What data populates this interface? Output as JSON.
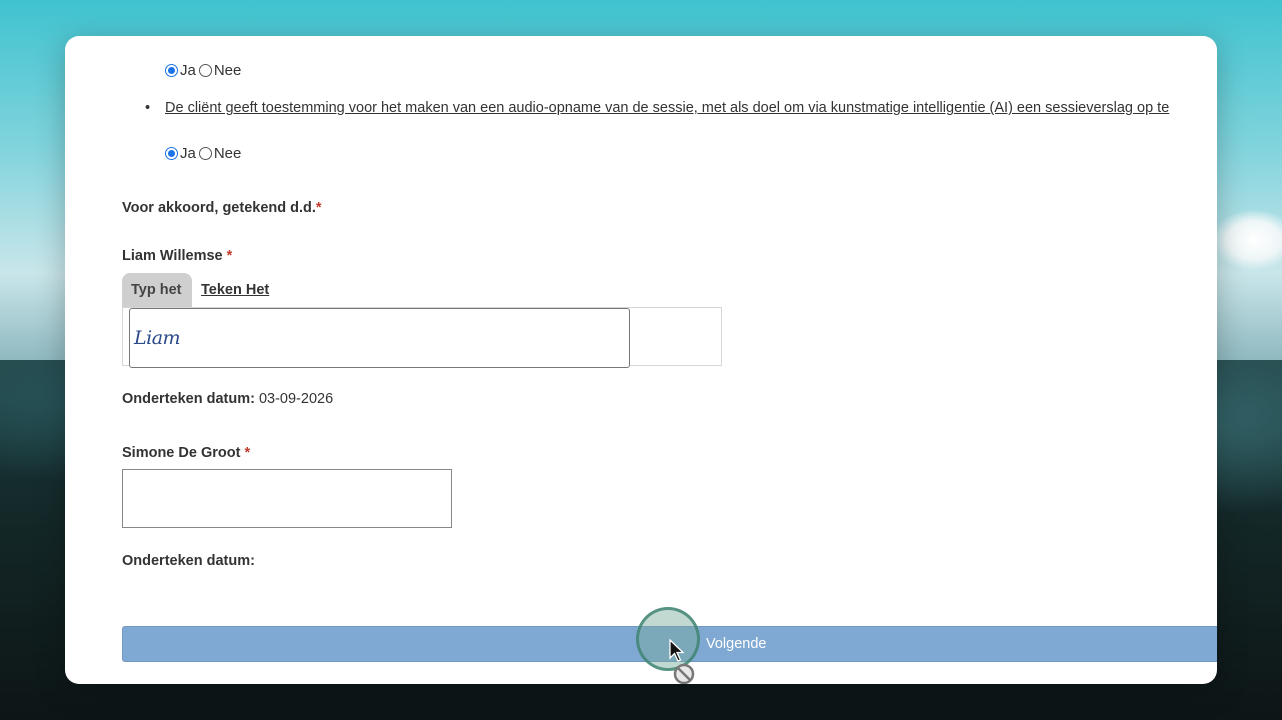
{
  "form": {
    "question1": {
      "yes_label": "Ja",
      "no_label": "Nee",
      "selected": "Ja"
    },
    "consent_text": "De cliënt geeft toestemming voor het maken van een audio-opname van de sessie, met als doel om via kunstmatige intelligentie (AI) een sessieverslag op te",
    "question2": {
      "yes_label": "Ja",
      "no_label": "Nee",
      "selected": "Ja"
    },
    "agreement_label": "Voor akkoord, getekend d.d.",
    "required_mark": "*",
    "signer1": {
      "name": "Liam Willemse",
      "required_mark": "*",
      "tab_type": "Typ het",
      "tab_draw": "Teken Het",
      "signature_value": "Liam",
      "date_label": "Onderteken datum:",
      "date_value": "03-09-2026"
    },
    "signer2": {
      "name": "Simone De Groot",
      "required_mark": "*",
      "date_label": "Onderteken datum:"
    },
    "next_button_label": "Volgende"
  },
  "colors": {
    "accent_radio": "#1a73e8",
    "button_bg": "#7fa8d2",
    "required": "#c0392b",
    "signature_ink": "#2a4a8a"
  }
}
